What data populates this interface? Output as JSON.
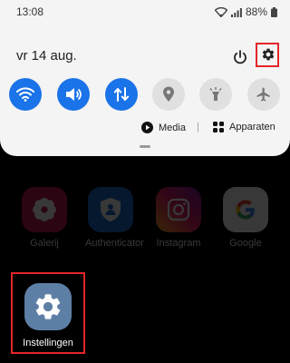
{
  "status_bar": {
    "time": "13:08",
    "battery": "88%"
  },
  "panel": {
    "date": "vr 14 aug.",
    "toggles": [
      {
        "name": "wifi",
        "state": "on"
      },
      {
        "name": "sound",
        "state": "on"
      },
      {
        "name": "mobile-data",
        "state": "on"
      },
      {
        "name": "location",
        "state": "off"
      },
      {
        "name": "flashlight",
        "state": "off"
      },
      {
        "name": "airplane-mode",
        "state": "off"
      }
    ],
    "media_label": "Media",
    "separator": "|",
    "devices_label": "Apparaten"
  },
  "apps": {
    "galerij": "Galerij",
    "authenticator": "Authenticator",
    "instagram": "Instagram",
    "google": "Google",
    "settings": "Instellingen"
  },
  "colors": {
    "accent": "#1a73e8",
    "highlight": "#e4262a",
    "panel_bg": "#f4f4f4",
    "settings_icon_bg": "#5e7fa5"
  }
}
